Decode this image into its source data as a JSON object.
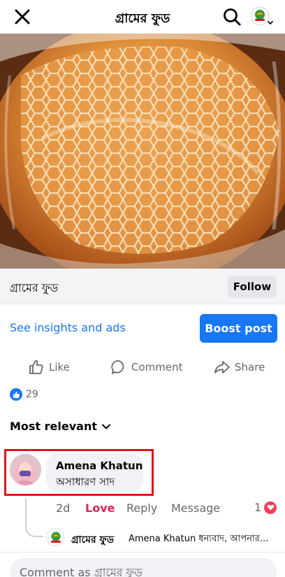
{
  "header": {
    "title": "গ্রামের ফুড",
    "close_icon": "close-icon",
    "search_icon": "search-icon",
    "profile_icon": "page-profile-icon"
  },
  "post": {
    "author": "গ্রামের ফুড",
    "follow_label": "Follow",
    "insights_label": "See insights and ads",
    "boost_label": "Boost post",
    "actions": {
      "like": "Like",
      "comment": "Comment",
      "share": "Share"
    },
    "reaction_count": "29"
  },
  "comments": {
    "sort_label": "Most relevant",
    "items": [
      {
        "author": "Amena Khatun",
        "text": "অসাধারণ সাদ",
        "time": "2d",
        "reaction_label": "Love",
        "reply_label": "Reply",
        "message_label": "Message",
        "reaction_count": "1",
        "reply": {
          "author": "গ্রামের ফুড",
          "snippet": "Amena Khatun ধন্যবাদ, আপনার..."
        }
      }
    ]
  },
  "composer": {
    "placeholder": "Comment as গ্রামের ফুড"
  },
  "colors": {
    "accent": "#1877f2",
    "love": "#e0245e",
    "highlight": "#e0141e"
  }
}
